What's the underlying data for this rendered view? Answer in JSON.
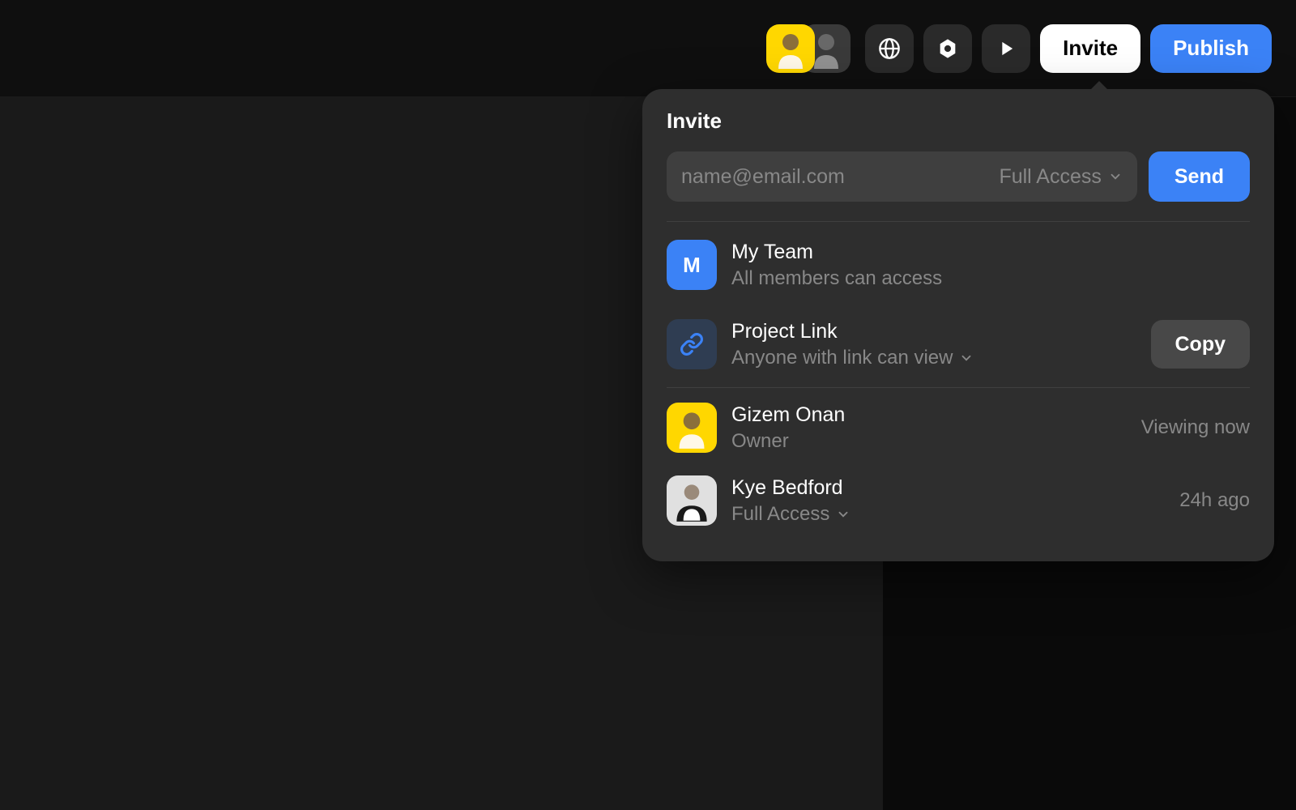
{
  "toolbar": {
    "invite_label": "Invite",
    "publish_label": "Publish"
  },
  "popover": {
    "title": "Invite",
    "email_placeholder": "name@email.com",
    "access_default": "Full Access",
    "send_label": "Send",
    "team": {
      "initial": "M",
      "name": "My Team",
      "description": "All members can access"
    },
    "link": {
      "name": "Project Link",
      "description": "Anyone with link can view",
      "copy_label": "Copy"
    },
    "members": [
      {
        "name": "Gizem Onan",
        "role": "Owner",
        "status": "Viewing now",
        "has_chevron": false
      },
      {
        "name": "Kye Bedford",
        "role": "Full Access",
        "status": "24h ago",
        "has_chevron": true
      }
    ]
  }
}
